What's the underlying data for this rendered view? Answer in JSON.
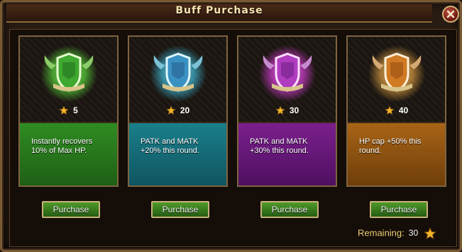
{
  "window": {
    "title": "Buff Purchase"
  },
  "cards": [
    {
      "cost": "5",
      "description": "Instantly recovers 10% of Max HP.",
      "button": "Purchase",
      "color": "#2f8c22",
      "glow": "#66ff44"
    },
    {
      "cost": "20",
      "description": "PATK and MATK +20% this round.",
      "button": "Purchase",
      "color": "#1a7f8b",
      "glow": "#44d8ff"
    },
    {
      "cost": "30",
      "description": "PATK and MATK +30% this round.",
      "button": "Purchase",
      "color": "#7b1f8d",
      "glow": "#ff44ff"
    },
    {
      "cost": "40",
      "description": "HP cap +50% this round.",
      "button": "Purchase",
      "color": "#a86416",
      "glow": "#ffb64a"
    }
  ],
  "footer": {
    "remaining_label": "Remaining:",
    "remaining_value": "30"
  },
  "icons": {
    "close": "close-icon",
    "cost": "star-icon",
    "emblem": "shield-emblem-icon"
  }
}
